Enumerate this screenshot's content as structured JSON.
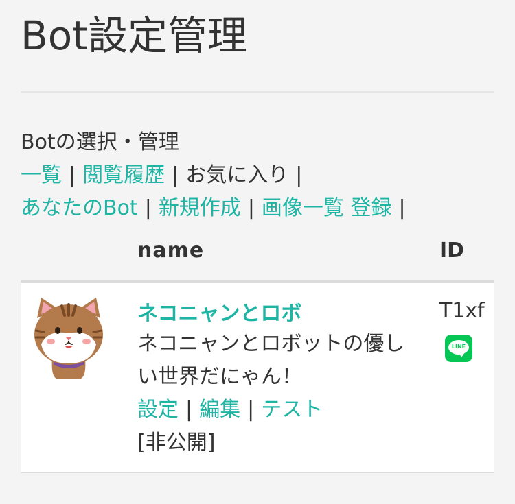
{
  "page": {
    "title": "Bot設定管理"
  },
  "nav": {
    "heading": "Botの選択・管理",
    "line1": [
      {
        "label": "一覧",
        "link": true
      },
      {
        "label": "閲覧履歴",
        "link": true
      },
      {
        "label": "お気に入り",
        "link": false
      }
    ],
    "line2": [
      {
        "label": "あなたのBot",
        "link": true
      },
      {
        "label": "新規作成",
        "link": true
      },
      {
        "label": "画像一覧 登録",
        "link": true
      }
    ],
    "separator": "|"
  },
  "table": {
    "headers": {
      "name": "name",
      "id": "ID"
    },
    "rows": [
      {
        "avatar_icon": "cat-avatar",
        "name": "ネコニャンとロボ",
        "description": "ネコニャンとロボットの優しい世界だにゃん！",
        "actions": {
          "settings": "設定",
          "edit": "編集",
          "test": "テスト"
        },
        "status": "[非公開]",
        "id": "T1xf",
        "platform_icon": "line-app-icon",
        "platform_label": "LINE"
      }
    ]
  },
  "colors": {
    "accent": "#1fb5a5",
    "text": "#333333",
    "background": "#f4f4f4",
    "line_green": "#06c755"
  }
}
